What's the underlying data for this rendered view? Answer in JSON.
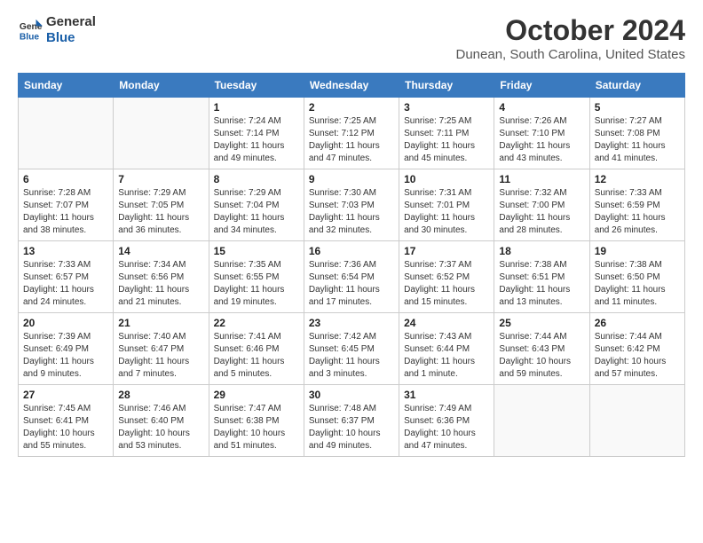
{
  "header": {
    "logo_line1": "General",
    "logo_line2": "Blue",
    "title": "October 2024",
    "subtitle": "Dunean, South Carolina, United States"
  },
  "weekdays": [
    "Sunday",
    "Monday",
    "Tuesday",
    "Wednesday",
    "Thursday",
    "Friday",
    "Saturday"
  ],
  "weeks": [
    [
      {
        "day": "",
        "sunrise": "",
        "sunset": "",
        "daylight": ""
      },
      {
        "day": "",
        "sunrise": "",
        "sunset": "",
        "daylight": ""
      },
      {
        "day": "1",
        "sunrise": "Sunrise: 7:24 AM",
        "sunset": "Sunset: 7:14 PM",
        "daylight": "Daylight: 11 hours and 49 minutes."
      },
      {
        "day": "2",
        "sunrise": "Sunrise: 7:25 AM",
        "sunset": "Sunset: 7:12 PM",
        "daylight": "Daylight: 11 hours and 47 minutes."
      },
      {
        "day": "3",
        "sunrise": "Sunrise: 7:25 AM",
        "sunset": "Sunset: 7:11 PM",
        "daylight": "Daylight: 11 hours and 45 minutes."
      },
      {
        "day": "4",
        "sunrise": "Sunrise: 7:26 AM",
        "sunset": "Sunset: 7:10 PM",
        "daylight": "Daylight: 11 hours and 43 minutes."
      },
      {
        "day": "5",
        "sunrise": "Sunrise: 7:27 AM",
        "sunset": "Sunset: 7:08 PM",
        "daylight": "Daylight: 11 hours and 41 minutes."
      }
    ],
    [
      {
        "day": "6",
        "sunrise": "Sunrise: 7:28 AM",
        "sunset": "Sunset: 7:07 PM",
        "daylight": "Daylight: 11 hours and 38 minutes."
      },
      {
        "day": "7",
        "sunrise": "Sunrise: 7:29 AM",
        "sunset": "Sunset: 7:05 PM",
        "daylight": "Daylight: 11 hours and 36 minutes."
      },
      {
        "day": "8",
        "sunrise": "Sunrise: 7:29 AM",
        "sunset": "Sunset: 7:04 PM",
        "daylight": "Daylight: 11 hours and 34 minutes."
      },
      {
        "day": "9",
        "sunrise": "Sunrise: 7:30 AM",
        "sunset": "Sunset: 7:03 PM",
        "daylight": "Daylight: 11 hours and 32 minutes."
      },
      {
        "day": "10",
        "sunrise": "Sunrise: 7:31 AM",
        "sunset": "Sunset: 7:01 PM",
        "daylight": "Daylight: 11 hours and 30 minutes."
      },
      {
        "day": "11",
        "sunrise": "Sunrise: 7:32 AM",
        "sunset": "Sunset: 7:00 PM",
        "daylight": "Daylight: 11 hours and 28 minutes."
      },
      {
        "day": "12",
        "sunrise": "Sunrise: 7:33 AM",
        "sunset": "Sunset: 6:59 PM",
        "daylight": "Daylight: 11 hours and 26 minutes."
      }
    ],
    [
      {
        "day": "13",
        "sunrise": "Sunrise: 7:33 AM",
        "sunset": "Sunset: 6:57 PM",
        "daylight": "Daylight: 11 hours and 24 minutes."
      },
      {
        "day": "14",
        "sunrise": "Sunrise: 7:34 AM",
        "sunset": "Sunset: 6:56 PM",
        "daylight": "Daylight: 11 hours and 21 minutes."
      },
      {
        "day": "15",
        "sunrise": "Sunrise: 7:35 AM",
        "sunset": "Sunset: 6:55 PM",
        "daylight": "Daylight: 11 hours and 19 minutes."
      },
      {
        "day": "16",
        "sunrise": "Sunrise: 7:36 AM",
        "sunset": "Sunset: 6:54 PM",
        "daylight": "Daylight: 11 hours and 17 minutes."
      },
      {
        "day": "17",
        "sunrise": "Sunrise: 7:37 AM",
        "sunset": "Sunset: 6:52 PM",
        "daylight": "Daylight: 11 hours and 15 minutes."
      },
      {
        "day": "18",
        "sunrise": "Sunrise: 7:38 AM",
        "sunset": "Sunset: 6:51 PM",
        "daylight": "Daylight: 11 hours and 13 minutes."
      },
      {
        "day": "19",
        "sunrise": "Sunrise: 7:38 AM",
        "sunset": "Sunset: 6:50 PM",
        "daylight": "Daylight: 11 hours and 11 minutes."
      }
    ],
    [
      {
        "day": "20",
        "sunrise": "Sunrise: 7:39 AM",
        "sunset": "Sunset: 6:49 PM",
        "daylight": "Daylight: 11 hours and 9 minutes."
      },
      {
        "day": "21",
        "sunrise": "Sunrise: 7:40 AM",
        "sunset": "Sunset: 6:47 PM",
        "daylight": "Daylight: 11 hours and 7 minutes."
      },
      {
        "day": "22",
        "sunrise": "Sunrise: 7:41 AM",
        "sunset": "Sunset: 6:46 PM",
        "daylight": "Daylight: 11 hours and 5 minutes."
      },
      {
        "day": "23",
        "sunrise": "Sunrise: 7:42 AM",
        "sunset": "Sunset: 6:45 PM",
        "daylight": "Daylight: 11 hours and 3 minutes."
      },
      {
        "day": "24",
        "sunrise": "Sunrise: 7:43 AM",
        "sunset": "Sunset: 6:44 PM",
        "daylight": "Daylight: 11 hours and 1 minute."
      },
      {
        "day": "25",
        "sunrise": "Sunrise: 7:44 AM",
        "sunset": "Sunset: 6:43 PM",
        "daylight": "Daylight: 10 hours and 59 minutes."
      },
      {
        "day": "26",
        "sunrise": "Sunrise: 7:44 AM",
        "sunset": "Sunset: 6:42 PM",
        "daylight": "Daylight: 10 hours and 57 minutes."
      }
    ],
    [
      {
        "day": "27",
        "sunrise": "Sunrise: 7:45 AM",
        "sunset": "Sunset: 6:41 PM",
        "daylight": "Daylight: 10 hours and 55 minutes."
      },
      {
        "day": "28",
        "sunrise": "Sunrise: 7:46 AM",
        "sunset": "Sunset: 6:40 PM",
        "daylight": "Daylight: 10 hours and 53 minutes."
      },
      {
        "day": "29",
        "sunrise": "Sunrise: 7:47 AM",
        "sunset": "Sunset: 6:38 PM",
        "daylight": "Daylight: 10 hours and 51 minutes."
      },
      {
        "day": "30",
        "sunrise": "Sunrise: 7:48 AM",
        "sunset": "Sunset: 6:37 PM",
        "daylight": "Daylight: 10 hours and 49 minutes."
      },
      {
        "day": "31",
        "sunrise": "Sunrise: 7:49 AM",
        "sunset": "Sunset: 6:36 PM",
        "daylight": "Daylight: 10 hours and 47 minutes."
      },
      {
        "day": "",
        "sunrise": "",
        "sunset": "",
        "daylight": ""
      },
      {
        "day": "",
        "sunrise": "",
        "sunset": "",
        "daylight": ""
      }
    ]
  ]
}
